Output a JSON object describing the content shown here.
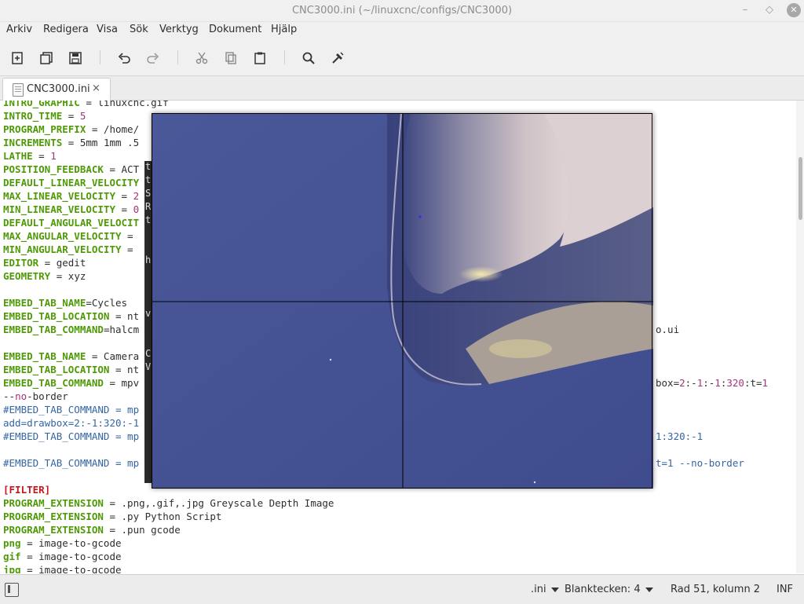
{
  "window": {
    "title": "CNC3000.ini (~/linuxcnc/configs/CNC3000)",
    "minimize_glyph": "–",
    "maximize_glyph": "◇",
    "close_glyph": "✕"
  },
  "menubar": {
    "items": [
      "Arkiv",
      "Redigera",
      "Visa",
      "Sök",
      "Verktyg",
      "Dokument",
      "Hjälp"
    ]
  },
  "toolbar": {
    "icons": [
      "new-document-icon",
      "open-document-icon",
      "save-icon",
      "undo-icon",
      "redo-icon",
      "cut-icon",
      "copy-icon",
      "paste-icon",
      "search-icon",
      "tools-icon"
    ]
  },
  "tab": {
    "label": "CNC3000.ini",
    "close_glyph": "×"
  },
  "editor": {
    "lines": [
      "INTRO_GRAPHIC = linuxcnc.gif",
      "INTRO_TIME = 5",
      "PROGRAM_PREFIX = /home/",
      "INCREMENTS = 5mm 1mm .5",
      "LATHE = 1",
      "POSITION_FEEDBACK = ACT",
      "DEFAULT_LINEAR_VELOCITY",
      "MAX_LINEAR_VELOCITY = 2",
      "MIN_LINEAR_VELOCITY = 0",
      "DEFAULT_ANGULAR_VELOCIT",
      "MAX_ANGULAR_VELOCITY = ",
      "MIN_ANGULAR_VELOCITY = ",
      "EDITOR = gedit",
      "GEOMETRY = xyz",
      "",
      "EMBED_TAB_NAME=Cycles",
      "EMBED_TAB_LOCATION = nt",
      "EMBED_TAB_COMMAND=halcm",
      "",
      "EMBED_TAB_NAME = Camera",
      "EMBED_TAB_LOCATION = nt",
      "EMBED_TAB_COMMAND = mpv",
      "--no-border",
      "#EMBED_TAB_COMMAND = mp",
      "add=drawbox=2:-1:320:-1",
      "#EMBED_TAB_COMMAND = mp",
      "",
      "#EMBED_TAB_COMMAND = mp",
      "",
      "[FILTER]",
      "PROGRAM_EXTENSION = .png,.gif,.jpg Greyscale Depth Image",
      "PROGRAM_EXTENSION = .py Python Script",
      "PROGRAM_EXTENSION = .pun gcode",
      "png = image-to-gcode",
      "gif = image-to-gcode",
      "jpg = image-to-gcode"
    ],
    "right_fragments": {
      "line18": "o.ui",
      "line22": "box=2:-1:-1:320:t=1",
      "line26": "1:320:-1",
      "line28": "t=1 --no-border"
    },
    "terminal_chars": [
      "t",
      "t",
      "S",
      "R",
      "t",
      "",
      "",
      "h",
      "",
      "",
      "",
      "v",
      "",
      "",
      "C",
      "V"
    ]
  },
  "statusbar": {
    "language": ".ini",
    "tab_width": "Blanktecken: 4",
    "position": "Rad 51, kolumn 2",
    "insert_mode": "INF"
  }
}
